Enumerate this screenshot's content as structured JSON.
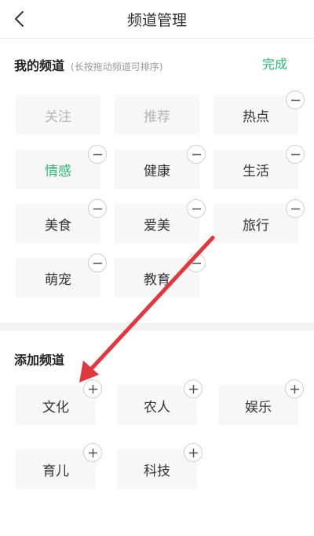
{
  "nav": {
    "title": "频道管理"
  },
  "my_channels": {
    "title": "我的频道",
    "hint": "(长按拖动频道可排序)",
    "done_label": "完成",
    "items": [
      {
        "label": "关注",
        "state": "fixed"
      },
      {
        "label": "推荐",
        "state": "fixed"
      },
      {
        "label": "热点",
        "state": "removable"
      },
      {
        "label": "情感",
        "state": "selected"
      },
      {
        "label": "健康",
        "state": "removable"
      },
      {
        "label": "生活",
        "state": "removable"
      },
      {
        "label": "美食",
        "state": "removable"
      },
      {
        "label": "爱美",
        "state": "removable"
      },
      {
        "label": "旅行",
        "state": "removable"
      },
      {
        "label": "萌宠",
        "state": "removable"
      },
      {
        "label": "教育",
        "state": "removable"
      }
    ]
  },
  "add_channels": {
    "title": "添加频道",
    "items": [
      {
        "label": "文化"
      },
      {
        "label": "农人"
      },
      {
        "label": "娱乐"
      },
      {
        "label": "育儿"
      },
      {
        "label": "科技"
      }
    ]
  },
  "colors": {
    "accent": "#2bb673",
    "annotation_arrow": "#e0383e",
    "chip_bg": "#f7f7f7",
    "muted_text": "#b5b5b5"
  }
}
